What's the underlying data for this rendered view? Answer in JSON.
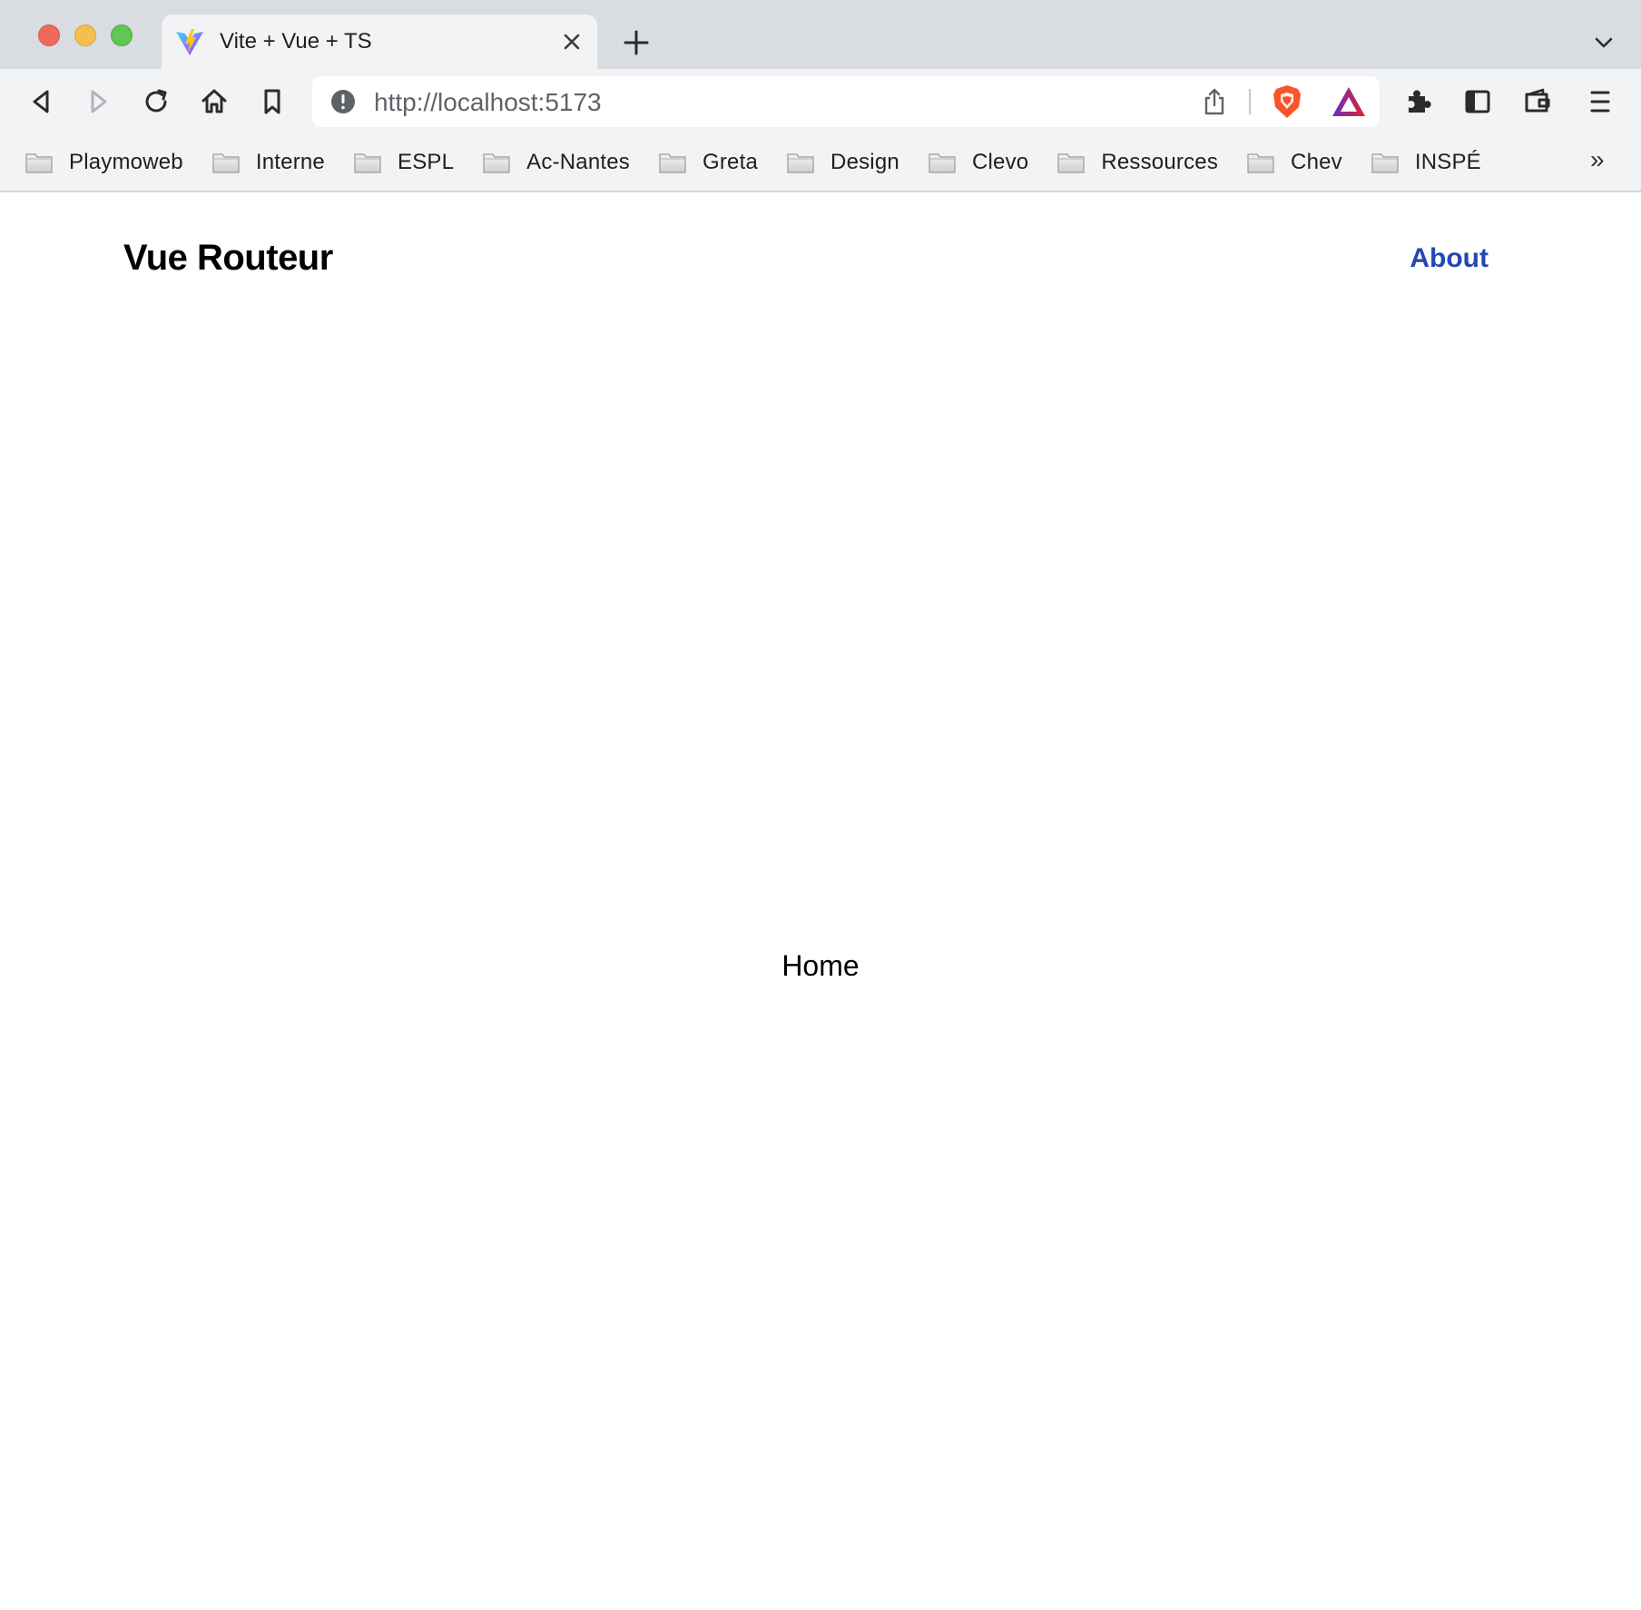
{
  "browser": {
    "tab": {
      "title": "Vite + Vue + TS"
    },
    "omnibox": {
      "url": "http://localhost:5173"
    },
    "bookmarks": [
      {
        "label": "Playmoweb"
      },
      {
        "label": "Interne"
      },
      {
        "label": "ESPL"
      },
      {
        "label": "Ac-Nantes"
      },
      {
        "label": "Greta"
      },
      {
        "label": "Design"
      },
      {
        "label": "Clevo"
      },
      {
        "label": "Ressources"
      },
      {
        "label": "Chev"
      },
      {
        "label": "INSPÉ"
      }
    ],
    "bookmarks_overflow": "»"
  },
  "page": {
    "header": {
      "title": "Vue Routeur",
      "nav_about": "About"
    },
    "content": {
      "text": "Home"
    }
  },
  "colors": {
    "link": "#2547b5",
    "tabstrip": "#d9dce0",
    "toolbar": "#f1f3f4"
  }
}
